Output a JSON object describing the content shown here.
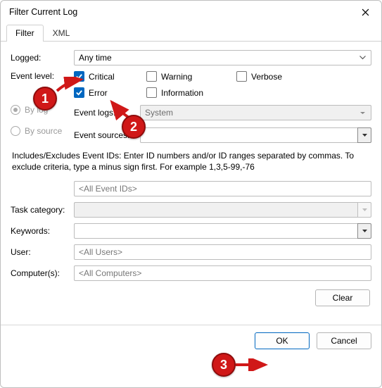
{
  "window": {
    "title": "Filter Current Log"
  },
  "tabs": {
    "filter": "Filter",
    "xml": "XML"
  },
  "form": {
    "logged_label": "Logged:",
    "logged_value": "Any time",
    "event_level_label": "Event level:",
    "levels": {
      "critical": "Critical",
      "warning": "Warning",
      "verbose": "Verbose",
      "error": "Error",
      "information": "Information"
    },
    "by_log": "By log",
    "by_source": "By source",
    "event_logs_label": "Event logs:",
    "event_logs_value": "System",
    "event_sources_label": "Event sources:",
    "event_sources_value": "",
    "desc": "Includes/Excludes Event IDs: Enter ID numbers and/or ID ranges separated by commas. To exclude criteria, type a minus sign first. For example 1,3,5-99,-76",
    "event_ids_placeholder": "<All Event IDs>",
    "task_category_label": "Task category:",
    "keywords_label": "Keywords:",
    "user_label": "User:",
    "user_value": "<All Users>",
    "computers_label": "Computer(s):",
    "computers_value": "<All Computers>"
  },
  "buttons": {
    "clear": "Clear",
    "ok": "OK",
    "cancel": "Cancel"
  },
  "annotations": {
    "b1": "1",
    "b2": "2",
    "b3": "3"
  }
}
